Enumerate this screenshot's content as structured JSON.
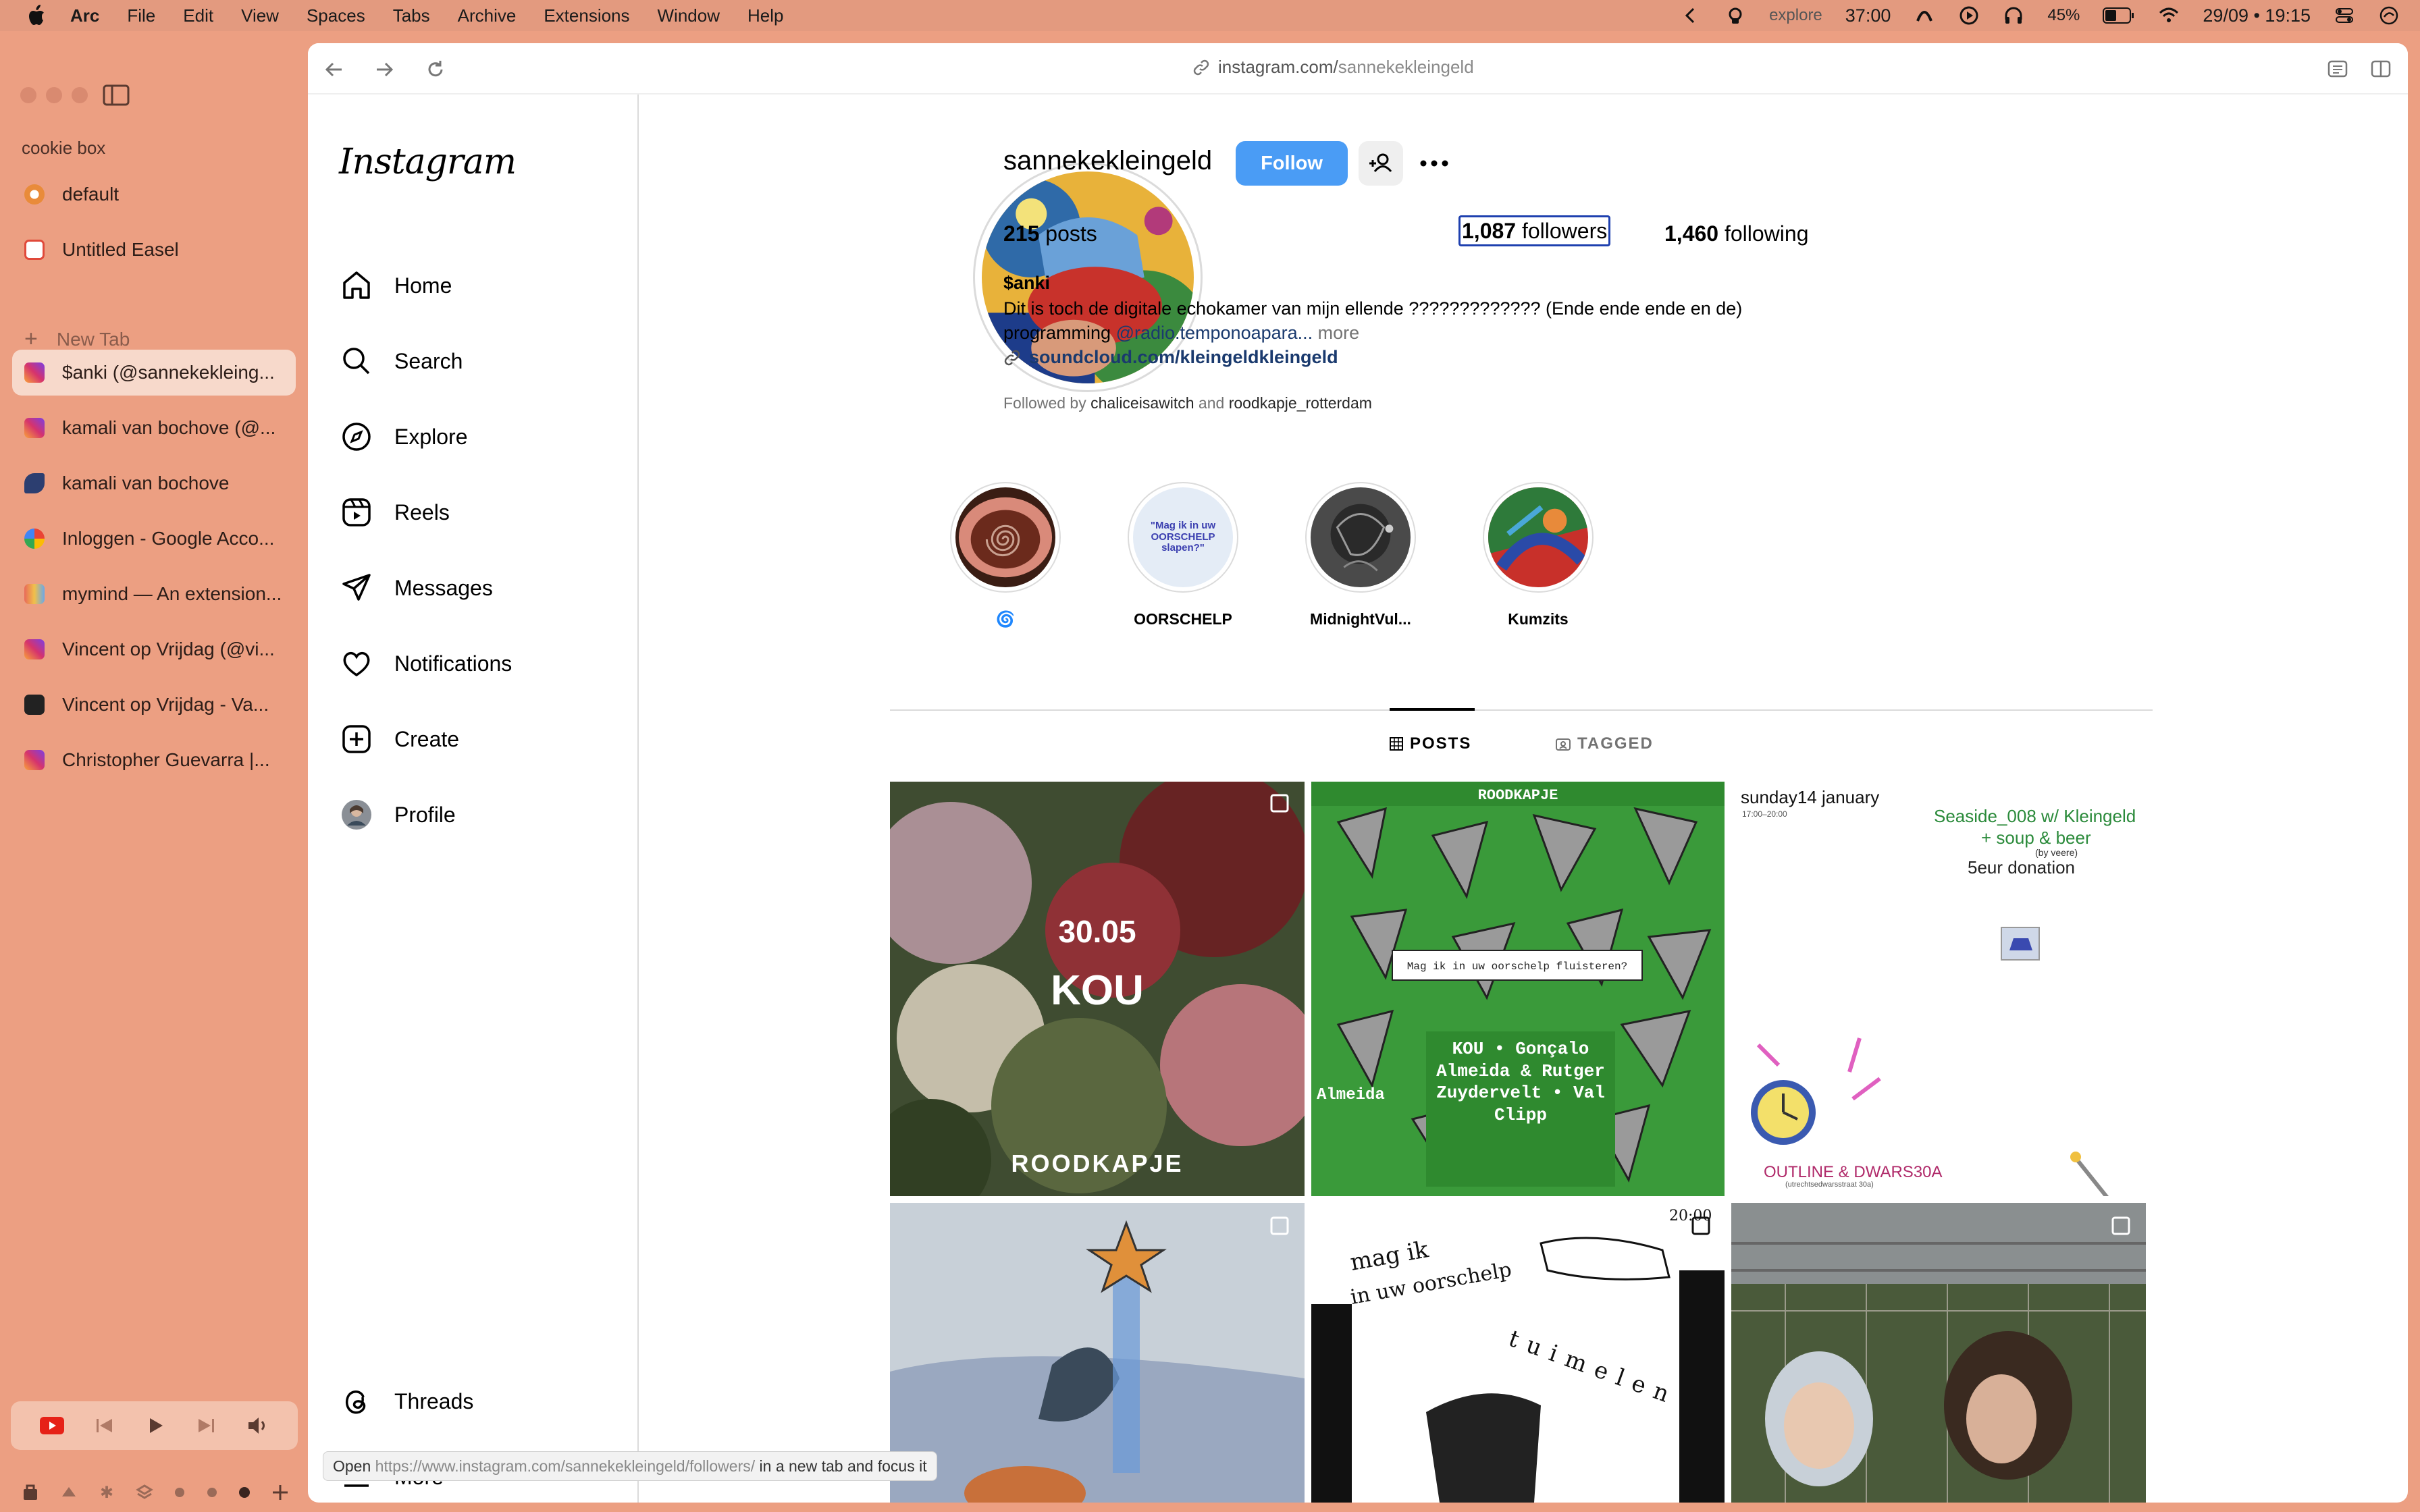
{
  "menubar": {
    "app": "Arc",
    "items": [
      "File",
      "Edit",
      "View",
      "Spaces",
      "Tabs",
      "Archive",
      "Extensions",
      "Window",
      "Help"
    ],
    "status_text": "explore",
    "timer": "37:00",
    "battery": "45%",
    "datetime": "29/09 • 19:15"
  },
  "sidebar": {
    "space_name": "cookie box",
    "pinned": [
      {
        "label": "default",
        "color": "#e98b3a"
      },
      {
        "label": "Untitled Easel",
        "color": "#e0493a"
      }
    ],
    "new_tab_label": "New Tab",
    "tabs": [
      {
        "label": "$anki (@sannekekleing...",
        "color": "#d6336c",
        "active": true
      },
      {
        "label": "kamali van bochove (@...",
        "color": "#d6336c"
      },
      {
        "label": "kamali van bochove",
        "color": "#2c3e70"
      },
      {
        "label": "Inloggen - Google Acco...",
        "color": "#4285f4"
      },
      {
        "label": "mymind — An extension...",
        "color": "#e86a5a"
      },
      {
        "label": "Vincent op Vrijdag (@vi...",
        "color": "#d6336c"
      },
      {
        "label": "Vincent op Vrijdag - Va...",
        "color": "#222222"
      },
      {
        "label": "Christopher Guevarra |...",
        "color": "#d6336c"
      }
    ]
  },
  "browser": {
    "url_host": "instagram.com/",
    "url_path": "sannekekleingeld"
  },
  "instagram": {
    "logo": "Instagram",
    "nav": [
      {
        "label": "Home",
        "icon": "home-icon"
      },
      {
        "label": "Search",
        "icon": "search-icon"
      },
      {
        "label": "Explore",
        "icon": "explore-icon"
      },
      {
        "label": "Reels",
        "icon": "reels-icon"
      },
      {
        "label": "Messages",
        "icon": "messages-icon"
      },
      {
        "label": "Notifications",
        "icon": "heart-icon"
      },
      {
        "label": "Create",
        "icon": "create-icon"
      },
      {
        "label": "Profile",
        "icon": "avatar"
      }
    ],
    "nav_bottom": [
      {
        "label": "Threads",
        "icon": "threads-icon"
      },
      {
        "label": "More",
        "icon": "menu-icon"
      }
    ]
  },
  "profile": {
    "username": "sannekekleingeld",
    "follow_label": "Follow",
    "posts_count": "215",
    "posts_label": "posts",
    "followers_count": "1,087",
    "followers_label": "followers",
    "following_count": "1,460",
    "following_label": "following",
    "name": "$anki",
    "bio_line1": "Dit is toch de digitale echokamer van mijn ellende ????????????? (Ende ende ende en de)",
    "bio_line2_prefix": "programming ",
    "bio_mention": "@radio.temponoapara...",
    "bio_more": " more",
    "link": "soundcloud.com/kleingeldkleingeld",
    "followed_by_prefix": "Followed by ",
    "followed_by_1": "chaliceisawitch",
    "followed_by_and": " and ",
    "followed_by_2": "roodkapje_rotterdam"
  },
  "highlights": [
    {
      "label": "🌀"
    },
    {
      "label": "OORSCHELP",
      "inner_text": "\"Mag ik in uw OORSCHELP slapen?\""
    },
    {
      "label": "MidnightVul..."
    },
    {
      "label": "Kumzits"
    }
  ],
  "tabs": {
    "posts": "POSTS",
    "tagged": "TAGGED"
  },
  "posts": [
    {
      "title": "30.05",
      "subtitle": "KOU",
      "footer": "ROODKAPJE"
    },
    {
      "top_text": "ROODKAPJE",
      "speech": "Mag ik in uw oorschelp fluisteren?",
      "lineup": "KOU • Gonçalo Almeida & Rutger Zuydervelt • Val Clipp",
      "side": "Almeida"
    },
    {
      "date": "sunday14 january",
      "time": "17:00–20:00",
      "line1": "Seaside_008 w/ Kleingeld",
      "line2": "+ soup & beer",
      "line3": "(by veere)",
      "line4": "5eur donation",
      "venue": "OUTLINE & DWARS30A",
      "address": "(utrechtsedwarsstraat 30a)"
    },
    {
      "kind": "illustration"
    },
    {
      "time": "20:00",
      "text1": "mag ik",
      "text2": "in uw oorschelp",
      "text3": "tuimelen"
    },
    {
      "kind": "photo"
    }
  ],
  "status_tooltip": {
    "prefix": "Open ",
    "url": "https://www.instagram.com/sannekekleingeld/followers/",
    "suffix": " in a new tab and focus it"
  }
}
